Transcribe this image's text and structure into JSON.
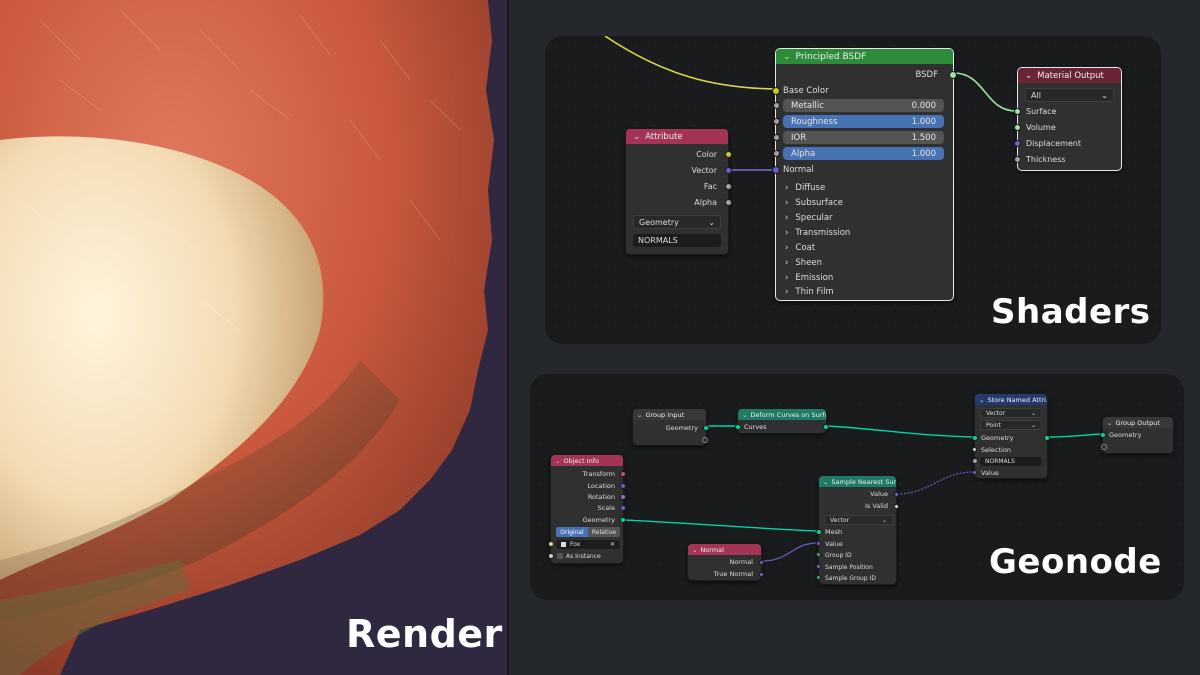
{
  "render": {
    "label": "Render"
  },
  "shaders": {
    "label": "Shaders",
    "principled": {
      "title": "Principled BSDF",
      "output": "BSDF",
      "base_color": "Base Color",
      "fields": [
        {
          "label": "Metallic",
          "value": "0.000",
          "highlighted": false
        },
        {
          "label": "Roughness",
          "value": "1.000",
          "highlighted": true
        },
        {
          "label": "IOR",
          "value": "1.500",
          "highlighted": false
        },
        {
          "label": "Alpha",
          "value": "1.000",
          "highlighted": true
        }
      ],
      "normal": "Normal",
      "panels": [
        "Diffuse",
        "Subsurface",
        "Specular",
        "Transmission",
        "Coat",
        "Sheen",
        "Emission",
        "Thin Film"
      ]
    },
    "attribute": {
      "title": "Attribute",
      "outputs": [
        "Color",
        "Vector",
        "Fac",
        "Alpha"
      ],
      "type_value": "Geometry",
      "name_value": "NORMALS"
    },
    "material_output": {
      "title": "Material Output",
      "target_value": "All",
      "inputs": [
        "Surface",
        "Volume",
        "Displacement",
        "Thickness"
      ]
    }
  },
  "geonode": {
    "label": "Geonode",
    "group_input": {
      "title": "Group Input",
      "output": "Geometry"
    },
    "deform": {
      "title": "Deform Curves on Surfa...",
      "output": "Curves"
    },
    "store": {
      "title": "Store Named Attri...",
      "type_value": "Vector",
      "domain_value": "Point",
      "inputs": [
        "Geometry",
        "Selection"
      ],
      "name_value": "NORMALS",
      "value": "Value"
    },
    "group_output": {
      "title": "Group Output",
      "input": "Geometry"
    },
    "object_info": {
      "title": "Object Info",
      "outputs": [
        "Transform",
        "Location",
        "Rotation",
        "Scale",
        "Geometry"
      ],
      "mode_original": "Original",
      "mode_relative": "Relative",
      "object_value": "Fox",
      "as_instance": "As Instance"
    },
    "sample_nearest": {
      "title": "Sample Nearest Surf...",
      "outputs": [
        "Value",
        "Is Valid"
      ],
      "type_value": "Vector",
      "inputs": [
        "Mesh",
        "Value",
        "Group ID",
        "Sample Position",
        "Sample Group ID"
      ]
    },
    "normal": {
      "title": "Normal",
      "outputs": [
        "Normal",
        "True Normal"
      ]
    }
  },
  "colors": {
    "shader_header": "#2d8c3a",
    "output_header": "#6b2433",
    "input_header": "#a33455",
    "geo_header": "#1f7a66",
    "store_header": "#243a6e",
    "socket_yellow": "#c7c729",
    "socket_gray": "#a1a1a1",
    "socket_vector": "#6363c7",
    "socket_green": "#00d6a3",
    "field_blue": "#4772b3"
  }
}
